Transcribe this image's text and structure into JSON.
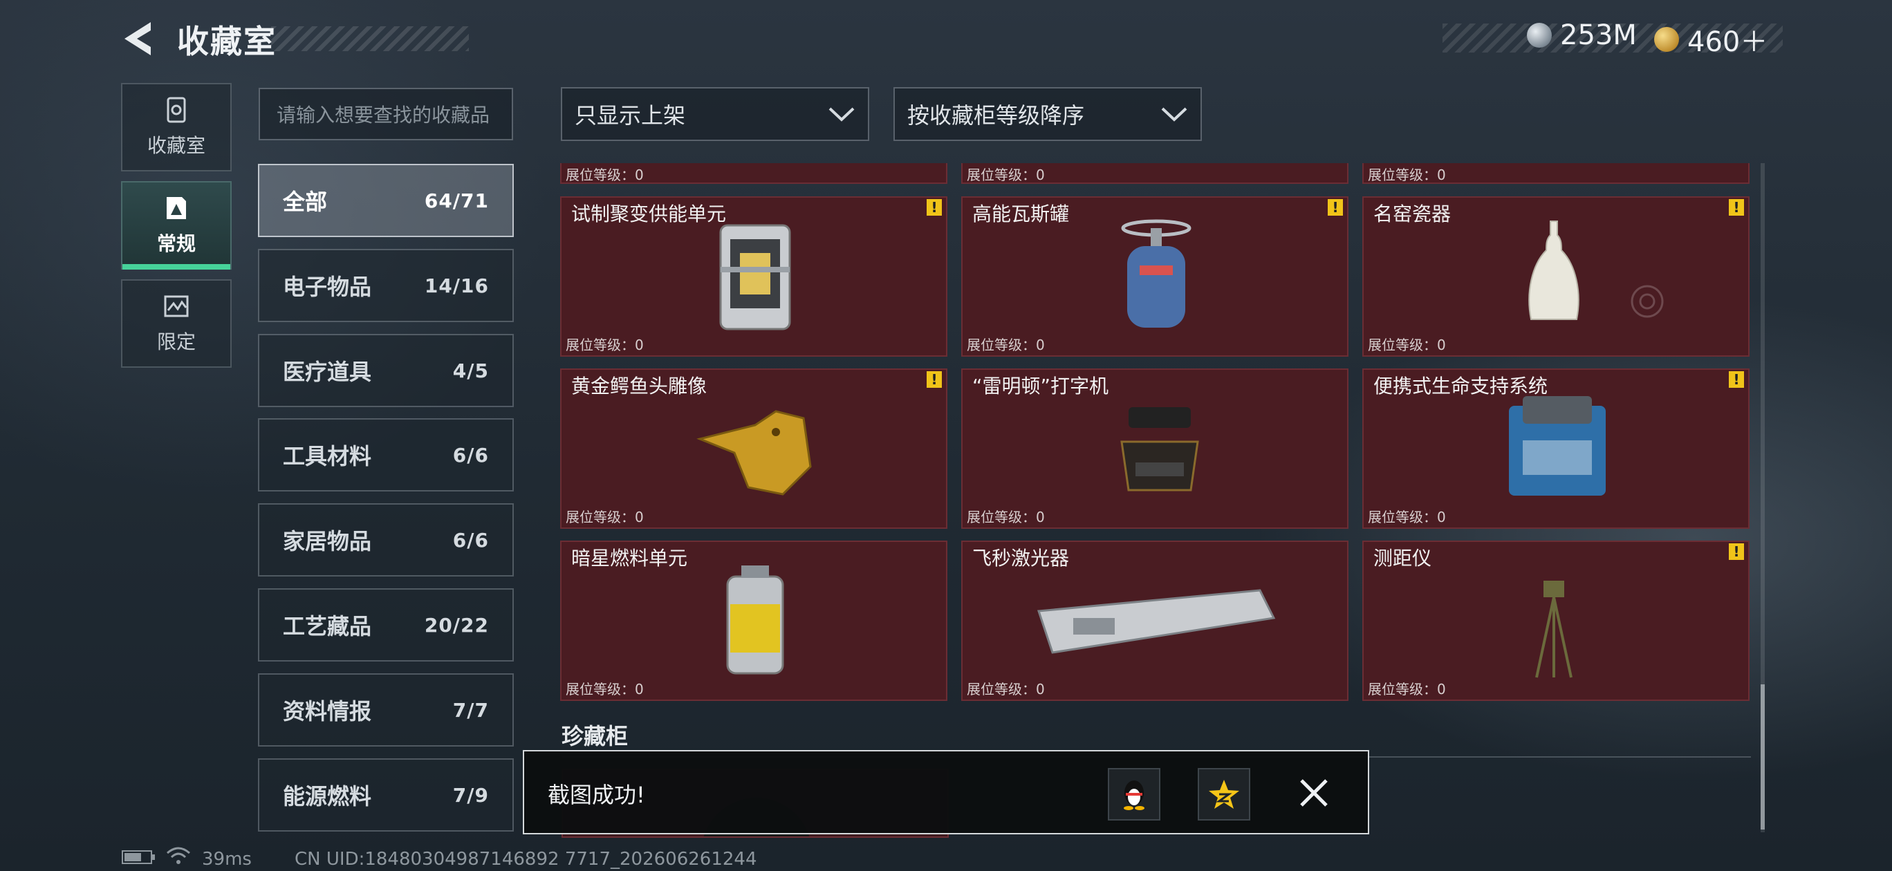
{
  "header": {
    "title": "收藏室",
    "currencies": [
      {
        "icon": "silver-coin-icon",
        "value": "253M"
      },
      {
        "icon": "gold-coin-icon",
        "value": "460＋"
      }
    ]
  },
  "nav": {
    "tabs": [
      {
        "label": "收藏室",
        "icon": "collection-room-icon",
        "active": false
      },
      {
        "label": "常规",
        "icon": "regular-icon",
        "active": true
      },
      {
        "label": "限定",
        "icon": "limited-icon",
        "active": false
      }
    ]
  },
  "search": {
    "placeholder": "请输入想要查找的收藏品"
  },
  "filters": {
    "filter_label": "只显示上架",
    "sort_label": "按收藏柜等级降序"
  },
  "categories": [
    {
      "label": "全部",
      "count": "64/71",
      "active": true
    },
    {
      "label": "电子物品",
      "count": "14/16"
    },
    {
      "label": "医疗道具",
      "count": "4/5"
    },
    {
      "label": "工具材料",
      "count": "6/6"
    },
    {
      "label": "家居物品",
      "count": "6/6"
    },
    {
      "label": "工艺藏品",
      "count": "20/22"
    },
    {
      "label": "资料情报",
      "count": "7/7"
    },
    {
      "label": "能源燃料",
      "count": "7/9"
    }
  ],
  "grid": {
    "level_label": "展位等级：0",
    "top_partial": [
      "展位等级：0",
      "展位等级：0",
      "展位等级：0"
    ],
    "items": [
      {
        "name": "试制聚变供能单元",
        "level": "展位等级：0",
        "alert": "!"
      },
      {
        "name": "高能瓦斯罐",
        "level": "展位等级：0",
        "alert": "!"
      },
      {
        "name": "名窑瓷器",
        "level": "展位等级：0",
        "alert": "!"
      },
      {
        "name": "黄金鳄鱼头雕像",
        "level": "展位等级：0",
        "alert": "!"
      },
      {
        "name": "“雷明顿”打字机",
        "level": "展位等级：0",
        "alert": ""
      },
      {
        "name": "便携式生命支持系统",
        "level": "展位等级：0",
        "alert": "!"
      },
      {
        "name": "暗星燃料单元",
        "level": "展位等级：0",
        "alert": ""
      },
      {
        "name": "飞秒激光器",
        "level": "展位等级：0",
        "alert": ""
      },
      {
        "name": "测距仪",
        "level": "展位等级：0",
        "alert": "!"
      }
    ]
  },
  "section": {
    "title": "珍藏柜"
  },
  "toast": {
    "message": "截图成功!"
  },
  "footer": {
    "ping": "39ms",
    "uid": "CN UID:18480304987146892 7717_202606261244"
  }
}
